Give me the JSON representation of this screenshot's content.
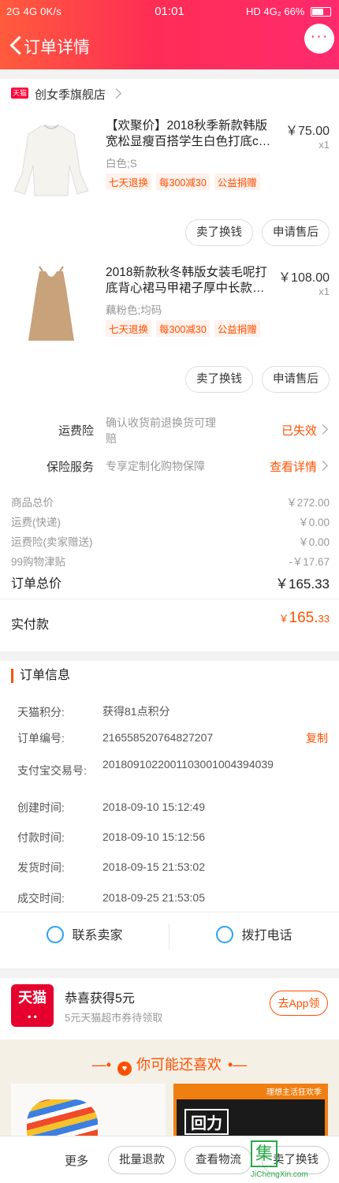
{
  "status_bar": {
    "left": "2G  4G  0K/s",
    "time": "01:01",
    "right": "HD 4G₂ 66%",
    "battery_level": 0.66
  },
  "header": {
    "title": "订单详情"
  },
  "shop": {
    "badge": "天猫",
    "name": "创女季旗舰店"
  },
  "products": [
    {
      "title": "【欢聚价】2018秋季新款韩版宽松显瘦百搭学生白色打底c…",
      "price": "￥75.00",
      "qty": "x1",
      "spec": "白色;S",
      "tags": [
        "七天退换",
        "每300减30",
        "公益捐赠"
      ],
      "actions": [
        "卖了换钱",
        "申请售后"
      ]
    },
    {
      "title": "2018新款秋冬韩版女装毛呢打底背心裙马甲裙子厚中长款…",
      "price": "￥108.00",
      "qty": "x1",
      "spec": "藕粉色;均码",
      "tags": [
        "七天退换",
        "每300减30",
        "公益捐赠"
      ],
      "actions": [
        "卖了换钱",
        "申请售后"
      ]
    }
  ],
  "insurance": [
    {
      "label": "运费险",
      "desc": "确认收货前退换货可理赔",
      "status": "已失效"
    },
    {
      "label": "保险服务",
      "desc": "专享定制化购物保障",
      "status": "查看详情"
    }
  ],
  "summary": {
    "rows": [
      {
        "label": "商品总价",
        "value": "￥272.00"
      },
      {
        "label": "运费(快递)",
        "value": "￥0.00"
      },
      {
        "label": "运费险(卖家赠送)",
        "value": "￥0.00"
      },
      {
        "label": "99购物津贴",
        "value": "-￥17.67"
      }
    ],
    "total_label": "订单总价",
    "total_value": "￥165.33",
    "paid_label": "实付款",
    "paid_symbol": "￥",
    "paid_int": "165.",
    "paid_dec": "33"
  },
  "order_info": {
    "heading": "订单信息",
    "rows": [
      {
        "key": "天猫积分:",
        "value": "获得81点积分"
      },
      {
        "key": "订单编号:",
        "value": "216558520764827207"
      },
      {
        "key": "支付宝交易号:",
        "value": "2018091022001103001004394039"
      },
      {
        "key": "创建时间:",
        "value": "2018-09-10 15:12:49"
      },
      {
        "key": "付款时间:",
        "value": "2018-09-10 15:12:56"
      },
      {
        "key": "发货时间:",
        "value": "2018-09-15 21:53:02"
      },
      {
        "key": "成交时间:",
        "value": "2018-09-25 21:53:05"
      }
    ],
    "copy_label": "复制",
    "contact_seller": "联系卖家",
    "call_phone": "拨打电话"
  },
  "coupon": {
    "logo_text": "天猫",
    "title": "恭喜获得5元",
    "subtitle": "5元天猫超市券待领取",
    "button": "去App领"
  },
  "recommend": {
    "title": "你可能还喜欢",
    "brand": "回力",
    "slogan": "理想主活狂欢季"
  },
  "bottom_bar": {
    "more": "更多",
    "buttons": [
      "批量退款",
      "查看物流",
      "卖了换钱"
    ]
  },
  "watermark": {
    "mark": "集",
    "url": "JiChengXin.com"
  }
}
